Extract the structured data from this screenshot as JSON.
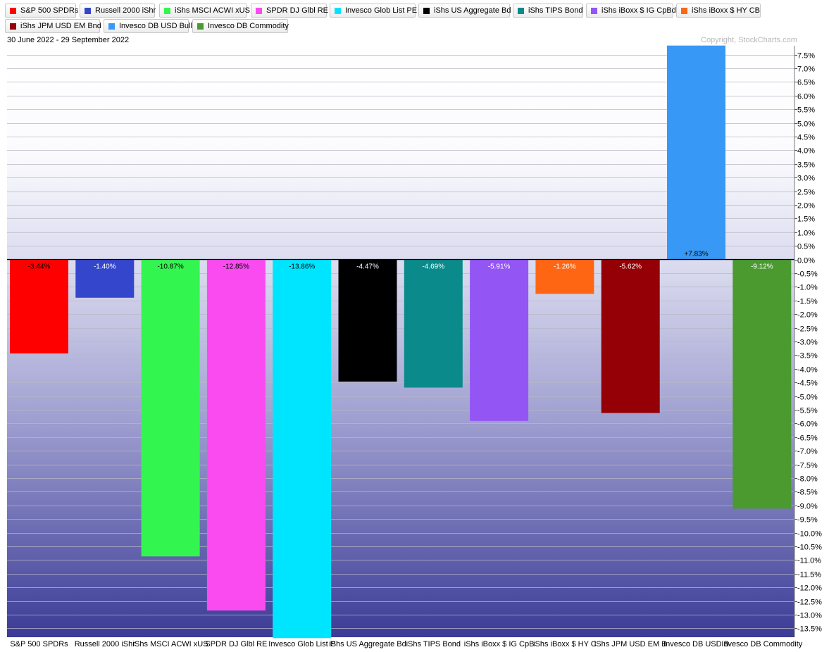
{
  "date_range": "30 June 2022 - 29 September 2022",
  "copyright": "Copyright, StockCharts.com",
  "legend": [
    {
      "label": "S&P 500 SPDRs",
      "color": "#ff0000"
    },
    {
      "label": "Russell 2000 iShr",
      "color": "#3446cc"
    },
    {
      "label": "iShs MSCI ACWI xUS",
      "color": "#33f550"
    },
    {
      "label": "SPDR DJ Glbl RE",
      "color": "#fa4bf0"
    },
    {
      "label": "Invesco Glob List PE",
      "color": "#00e5ff"
    },
    {
      "label": "iShs US Aggregate Bd",
      "color": "#000000"
    },
    {
      "label": "iShs TIPS Bond",
      "color": "#0a8a8a"
    },
    {
      "label": "iShs iBoxx $ IG CpBd",
      "color": "#9455f5"
    },
    {
      "label": "iShs iBoxx $ HY CB",
      "color": "#ff6614"
    },
    {
      "label": "iShs JPM USD EM Bnd",
      "color": "#940005"
    },
    {
      "label": "Invesco DB USD Bull",
      "color": "#3898f5"
    },
    {
      "label": "Invesco DB Commodity",
      "color": "#4a9a30"
    }
  ],
  "chart_data": {
    "type": "bar",
    "title": "",
    "xlabel": "",
    "ylabel": "",
    "categories": [
      "S&P 500 SPDRs",
      "Russell 2000 iShr",
      "iShs MSCI ACWI xUS",
      "SPDR DJ Glbl RE",
      "Invesco Glob List PE",
      "iShs US Aggregate Bd",
      "iShs TIPS Bond",
      "iShs iBoxx $ IG CpBd",
      "iShs iBoxx $ HY CB",
      "iShs JPM USD EM Bnd",
      "Invesco DB USD Bull",
      "Invesco DB Commodity"
    ],
    "category_labels": [
      "S&P 500 SPDRs",
      "Russell 2000 iShr",
      "iShs MSCI ACWI xUS",
      "SPDR DJ Glbl RE",
      "Invesco Glob List P",
      "iShs US Aggregate Bd",
      "iShs TIPS Bond",
      "iShs iBoxx $ IG CpB",
      "iShs iBoxx $ HY C",
      "iShs JPM USD EM B",
      "Invesco DB USD B",
      "Invesco DB Commodity"
    ],
    "values": [
      -3.44,
      -1.4,
      -10.87,
      -12.85,
      -13.86,
      -4.47,
      -4.69,
      -5.91,
      -1.26,
      -5.62,
      7.83,
      -9.12
    ],
    "value_labels": [
      "-3.44%",
      "-1.40%",
      "-10.87%",
      "-12.85%",
      "-13.86%",
      "-4.47%",
      "-4.69%",
      "-5.91%",
      "-1.26%",
      "-5.62%",
      "+7.83%",
      "-9.12%"
    ],
    "label_colors": [
      "#000000",
      "#ffffff",
      "#000000",
      "#000000",
      "#000000",
      "#ffffff",
      "#ffffff",
      "#ffffff",
      "#ffffff",
      "#ffffff",
      "#000000",
      "#ffffff"
    ],
    "colors": [
      "#ff0000",
      "#3446cc",
      "#33f550",
      "#fa4bf0",
      "#00e5ff",
      "#000000",
      "#0a8a8a",
      "#9455f5",
      "#ff6614",
      "#940005",
      "#3898f5",
      "#4a9a30"
    ],
    "ylim": [
      -13.86,
      7.83
    ],
    "yticks": [
      7.5,
      7.0,
      6.5,
      6.0,
      5.5,
      5.0,
      4.5,
      4.0,
      3.5,
      3.0,
      2.5,
      2.0,
      1.5,
      1.0,
      0.5,
      0.0,
      -0.5,
      -1.0,
      -1.5,
      -2.0,
      -2.5,
      -3.0,
      -3.5,
      -4.0,
      -4.5,
      -5.0,
      -5.5,
      -6.0,
      -6.5,
      -7.0,
      -7.5,
      -8.0,
      -8.5,
      -9.0,
      -9.5,
      -10.0,
      -10.5,
      -11.0,
      -11.5,
      -12.0,
      -12.5,
      -13.0,
      -13.5
    ],
    "ytick_labels": [
      "7.5%",
      "7.0%",
      "6.5%",
      "6.0%",
      "5.5%",
      "5.0%",
      "4.5%",
      "4.0%",
      "3.5%",
      "3.0%",
      "2.5%",
      "2.0%",
      "1.5%",
      "1.0%",
      "0.5%",
      "0.0%",
      "-0.5%",
      "-1.0%",
      "-1.5%",
      "-2.0%",
      "-2.5%",
      "-3.0%",
      "-3.5%",
      "-4.0%",
      "-4.5%",
      "-5.0%",
      "-5.5%",
      "-6.0%",
      "-6.5%",
      "-7.0%",
      "-7.5%",
      "-8.0%",
      "-8.5%",
      "-9.0%",
      "-9.5%",
      "-10.0%",
      "-10.5%",
      "-11.0%",
      "-11.5%",
      "-12.0%",
      "-12.5%",
      "-13.0%",
      "-13.5%"
    ],
    "grid": true,
    "legend_position": "top"
  }
}
